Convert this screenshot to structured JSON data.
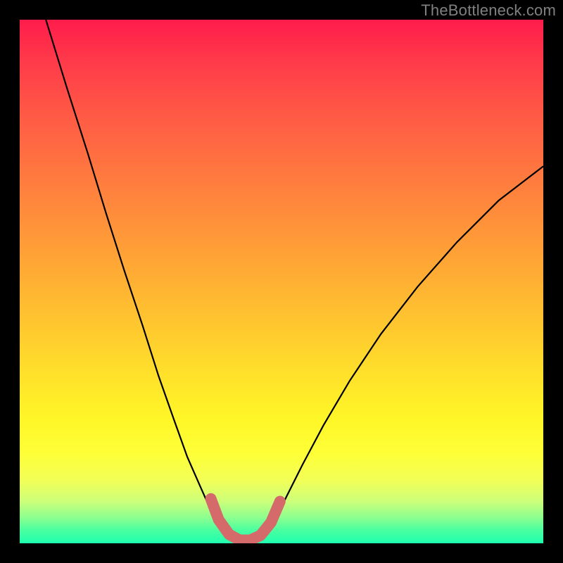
{
  "watermark": "TheBottleneck.com",
  "chart_data": {
    "type": "line",
    "title": "",
    "xlabel": "",
    "ylabel": "",
    "xlim": [
      0,
      1
    ],
    "ylim": [
      0,
      1
    ],
    "series": [
      {
        "name": "left-curve",
        "x": [
          0.05,
          0.09,
          0.13,
          0.165,
          0.2,
          0.235,
          0.265,
          0.295,
          0.32,
          0.345,
          0.365,
          0.385,
          0.4
        ],
        "y": [
          1.0,
          0.87,
          0.745,
          0.63,
          0.52,
          0.415,
          0.32,
          0.235,
          0.165,
          0.108,
          0.063,
          0.03,
          0.01
        ]
      },
      {
        "name": "right-curve",
        "x": [
          0.47,
          0.488,
          0.51,
          0.54,
          0.58,
          0.63,
          0.69,
          0.76,
          0.835,
          0.915,
          1.0
        ],
        "y": [
          0.015,
          0.045,
          0.09,
          0.15,
          0.225,
          0.31,
          0.4,
          0.49,
          0.575,
          0.655,
          0.72
        ]
      },
      {
        "name": "thick-bottom",
        "x": [
          0.365,
          0.38,
          0.4,
          0.42,
          0.44,
          0.46,
          0.48,
          0.497
        ],
        "y": [
          0.085,
          0.045,
          0.017,
          0.006,
          0.006,
          0.015,
          0.04,
          0.08
        ]
      }
    ],
    "colors": {
      "curve": "#000000",
      "thick": "#d46a6a"
    },
    "gradient_stops": [
      {
        "pos": 0.0,
        "color": "#ff1c4b"
      },
      {
        "pos": 0.3,
        "color": "#ff7a3f"
      },
      {
        "pos": 0.66,
        "color": "#ffdc2b"
      },
      {
        "pos": 0.83,
        "color": "#fdff37"
      },
      {
        "pos": 0.95,
        "color": "#8eff8e"
      },
      {
        "pos": 1.0,
        "color": "#1fffb0"
      }
    ]
  }
}
